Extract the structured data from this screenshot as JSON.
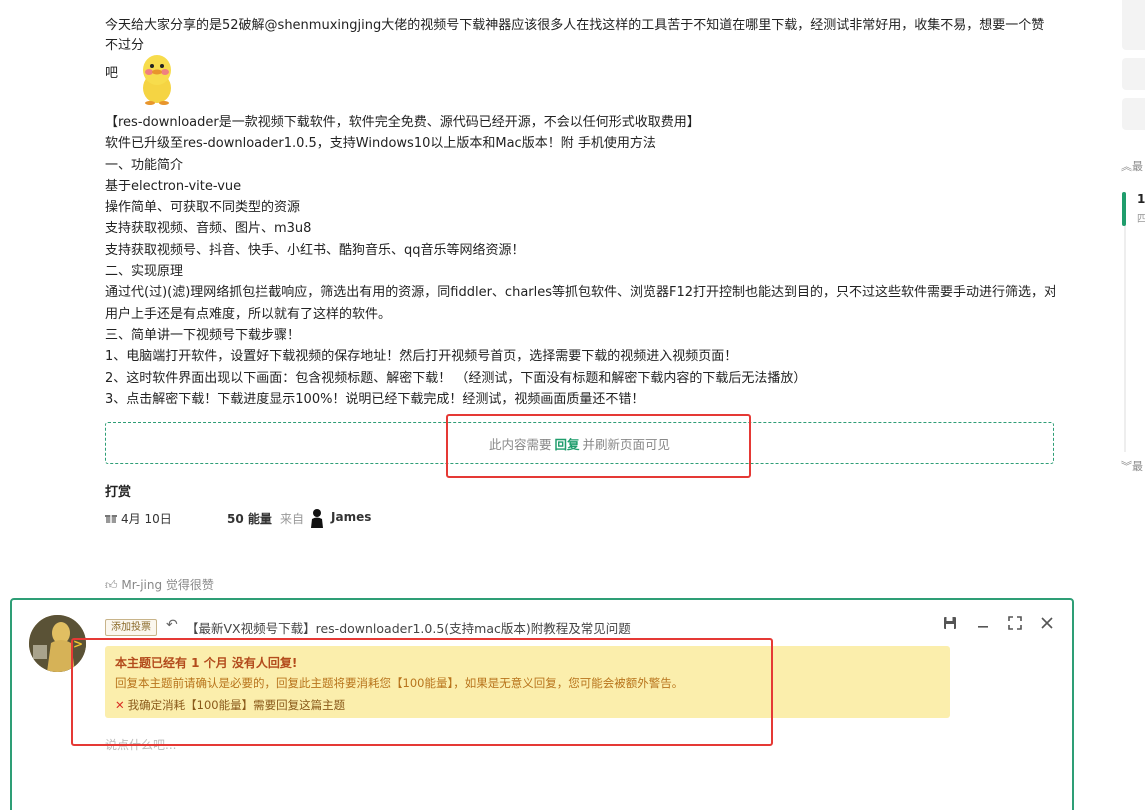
{
  "post": {
    "intro": "今天给大家分享的是52破解@shenmuxingjing大佬的视频号下载神器应该很多人在找这样的工具苦于不知道在哪里下载，经测试非常好用，收集不易，想要一个赞不过分",
    "intro_tail": "吧",
    "lines": [
      "【res-downloader是一款视频下载软件，软件完全免费、源代码已经开源，不会以任何形式收取费用】",
      "软件已升级至res-downloader1.0.5，支持Windows10以上版本和Mac版本！附 手机使用方法",
      "一、功能简介",
      "基于electron-vite-vue",
      "操作简单、可获取不同类型的资源",
      "支持获取视频、音频、图片、m3u8",
      "支持获取视频号、抖音、快手、小红书、酷狗音乐、qq音乐等网络资源！",
      "二、实现原理",
      "通过代(过)(滤)理网络抓包拦截响应，筛选出有用的资源，同fiddler、charles等抓包软件、浏览器F12打开控制也能达到目的，只不过这些软件需要手动进行筛选，对于小白",
      "用户上手还是有点难度，所以就有了这样的软件。",
      "三、简单讲一下视频号下载步骤！",
      "1、电脑端打开软件，设置好下载视频的保存地址！然后打开视频号首页，选择需要下载的视频进入视频页面！",
      "2、这时软件界面出现以下画面：包含视频标题、解密下载！ （经测试，下面没有标题和解密下载内容的下载后无法播放）",
      "3、点击解密下载！下载进度显示100%！说明已经下载完成！经测试，视频画面质量还不错！"
    ],
    "hidden": {
      "prefix": "此内容需要",
      "link": "回复",
      "suffix": "并刷新页面可见"
    }
  },
  "reward": {
    "title": "打赏",
    "date": "4月 10日",
    "energy": "50 能量",
    "from": "来自",
    "user": "James"
  },
  "likes": "Mr-jing 觉得很赞",
  "reply": {
    "tag": "添加投票",
    "title": "【最新VX视频号下载】res-downloader1.0.5(支持mac版本)附教程及常见问题",
    "warn_title": "本主题已经有 1 个月 没有人回复!",
    "warn_desc": "回复本主题前请确认是必要的，回复此主题将要消耗您【100能量】，如果是无意义回复，您可能会被额外警告。",
    "warn_confirm": "我确定消耗【100能量】需要回复这篇主题",
    "placeholder": "说点什么吧..."
  },
  "sidebar": {
    "top_label": "最",
    "num": "1",
    "sub": "四",
    "bottom_label": "最"
  },
  "colors": {
    "accent": "#2e9e76",
    "highlight": "#e53935",
    "warn_bg": "#fbeeac"
  }
}
